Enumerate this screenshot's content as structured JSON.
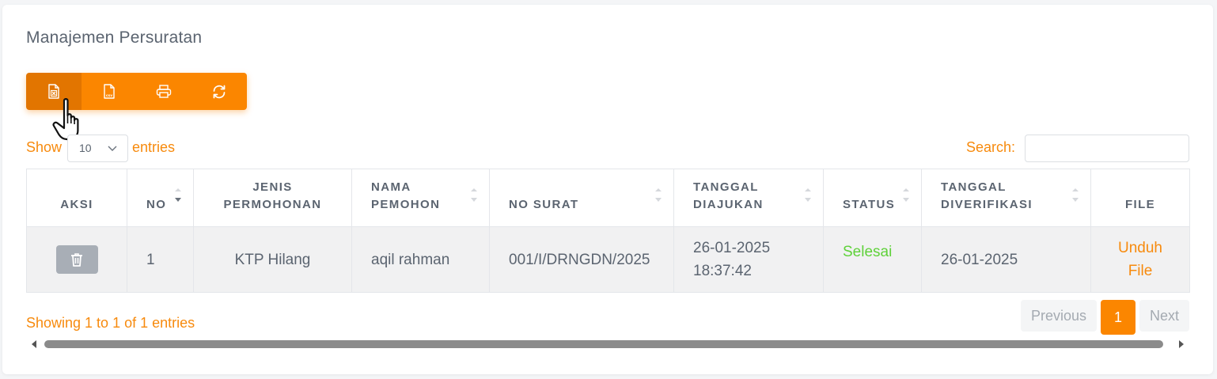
{
  "page": {
    "title": "Manajemen Persuratan"
  },
  "toolbar": {
    "buttons": [
      {
        "icon": "excel-file-icon"
      },
      {
        "icon": "csv-file-icon",
        "badge": "csv"
      },
      {
        "icon": "printer-icon"
      },
      {
        "icon": "refresh-icon"
      }
    ]
  },
  "length_menu": {
    "show_label": "Show",
    "value": "10",
    "entries_label": "entries"
  },
  "search": {
    "label": "Search:",
    "value": ""
  },
  "table": {
    "columns": [
      "Aksi",
      "No",
      "Jenis Permohonan",
      "Nama Pemohon",
      "No Surat",
      "Tanggal Diajukan",
      "Status",
      "Tanggal Diverifikasi",
      "File"
    ],
    "rows": [
      {
        "no": "1",
        "jenis": "KTP Hilang",
        "nama": "aqil rahman",
        "no_surat": "001/I/DRNGDN/2025",
        "tgl_diajukan_date": "26-01-2025",
        "tgl_diajukan_time": "18:37:42",
        "status": "Selesai",
        "tgl_diverifikasi": "26-01-2025",
        "file_line1": "Unduh",
        "file_line2": "File"
      }
    ]
  },
  "footer": {
    "info": "Showing 1 to 1 of 1 entries",
    "prev": "Previous",
    "current_page": "1",
    "next": "Next"
  },
  "colors": {
    "accent": "#fb8600",
    "accent_text": "#f78a0d",
    "success": "#5fd13a",
    "delete_button": "#a8aeb6"
  }
}
